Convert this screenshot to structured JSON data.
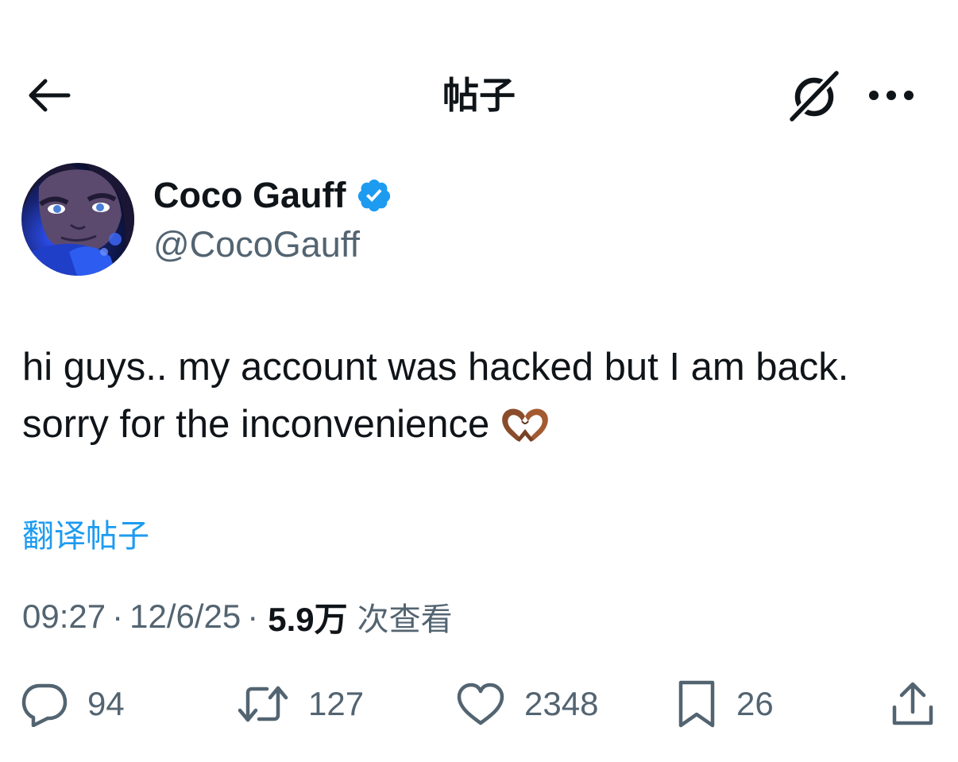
{
  "header": {
    "title": "帖子",
    "icons": {
      "back": "arrow-left-icon",
      "grok": "grok-icon",
      "more": "more-horizontal-icon"
    }
  },
  "author": {
    "name": "Coco Gauff",
    "handle": "@CocoGauff",
    "verified": true,
    "verified_color": "#1d9bf0"
  },
  "tweet": {
    "lines": [
      "hi guys.. my account was hacked but I am back.",
      "sorry for the inconvenience"
    ],
    "emoji": "heart-hands-emoji",
    "translate_label": "翻译帖子"
  },
  "meta": {
    "time": "09:27",
    "date": "12/6/25",
    "views_count": "5.9万",
    "views_label": "次查看"
  },
  "actions": {
    "reply_count": "94",
    "repost_count": "127",
    "like_count": "2348",
    "bookmark_count": "26"
  },
  "colors": {
    "text_primary": "#0f1419",
    "text_secondary": "#536471",
    "accent": "#1d9bf0"
  }
}
